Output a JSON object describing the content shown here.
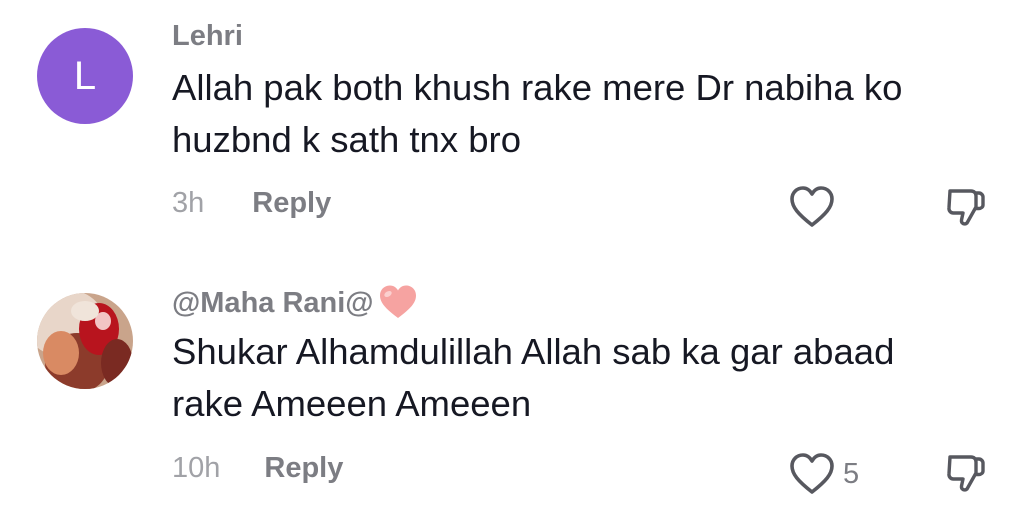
{
  "comments": [
    {
      "username": "Lehri",
      "avatar_letter": "L",
      "avatar_color": "#8a5bd6",
      "text": "Allah pak both khush rake mere Dr nabiha ko\nhuzbnd k sath tnx bro",
      "time": "3h",
      "reply_label": "Reply",
      "like_count": "",
      "icons": {
        "like": "heart-outline-icon",
        "dislike": "thumbs-down-icon"
      }
    },
    {
      "username": "@Maha Rani@",
      "username_emoji": "pink-heart-emoji",
      "avatar": "profile-photo",
      "text": "Shukar Alhamdulillah Allah sab ka gar abaad\nrake Ameeen Ameeen",
      "time": "10h",
      "reply_label": "Reply",
      "like_count": "5",
      "icons": {
        "like": "heart-outline-icon",
        "dislike": "thumbs-down-icon"
      }
    }
  ],
  "colors": {
    "username": "#7c7d83",
    "text": "#161823",
    "timestamp": "#a1a2a7",
    "icon": "#57585f"
  }
}
